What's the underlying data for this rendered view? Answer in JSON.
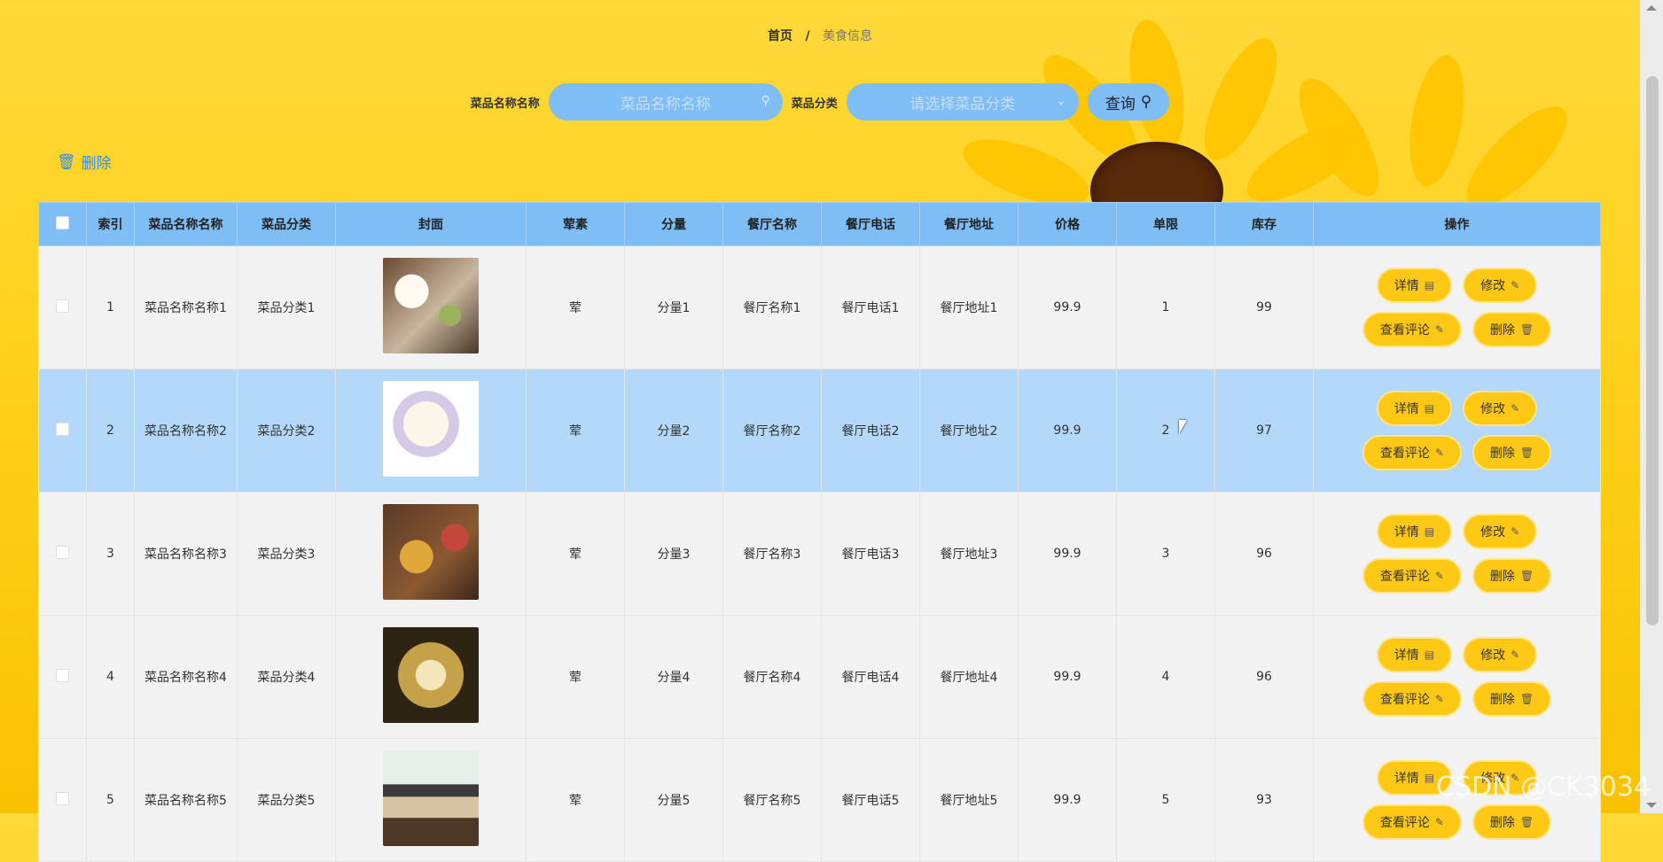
{
  "breadcrumb": {
    "home": "首页",
    "separator": "/",
    "current": "美食信息"
  },
  "search": {
    "name_label": "菜品名称名称",
    "name_placeholder": "菜品名称名称",
    "category_label": "菜品分类",
    "category_placeholder": "请选择菜品分类",
    "query_label": "查询"
  },
  "actions": {
    "delete_label": "删除"
  },
  "table": {
    "headers": [
      "",
      "索引",
      "菜品名称名称",
      "菜品分类",
      "封面",
      "荤素",
      "分量",
      "餐厅名称",
      "餐厅电话",
      "餐厅地址",
      "价格",
      "单限",
      "库存",
      "操作"
    ],
    "rows": [
      {
        "index": "1",
        "name": "菜品名称名称1",
        "category": "菜品分类1",
        "type": "荤",
        "portion": "分量1",
        "restaurant": "餐厅名称1",
        "phone": "餐厅电话1",
        "address": "餐厅地址1",
        "price": "99.9",
        "limit": "1",
        "stock": "99"
      },
      {
        "index": "2",
        "name": "菜品名称名称2",
        "category": "菜品分类2",
        "type": "荤",
        "portion": "分量2",
        "restaurant": "餐厅名称2",
        "phone": "餐厅电话2",
        "address": "餐厅地址2",
        "price": "99.9",
        "limit": "2",
        "stock": "97"
      },
      {
        "index": "3",
        "name": "菜品名称名称3",
        "category": "菜品分类3",
        "type": "荤",
        "portion": "分量3",
        "restaurant": "餐厅名称3",
        "phone": "餐厅电话3",
        "address": "餐厅地址3",
        "price": "99.9",
        "limit": "3",
        "stock": "96"
      },
      {
        "index": "4",
        "name": "菜品名称名称4",
        "category": "菜品分类4",
        "type": "荤",
        "portion": "分量4",
        "restaurant": "餐厅名称4",
        "phone": "餐厅电话4",
        "address": "餐厅地址4",
        "price": "99.9",
        "limit": "4",
        "stock": "96"
      },
      {
        "index": "5",
        "name": "菜品名称名称5",
        "category": "菜品分类5",
        "type": "荤",
        "portion": "分量5",
        "restaurant": "餐厅名称5",
        "phone": "餐厅电话5",
        "address": "餐厅地址5",
        "price": "99.9",
        "limit": "5",
        "stock": "93"
      }
    ],
    "row_buttons": {
      "detail": "详情",
      "edit": "修改",
      "comments": "查看评论",
      "delete": "删除"
    }
  },
  "watermark": "CSDN @CK3034",
  "colors": {
    "primary_blue": "#7fbdf5",
    "button_yellow": "#ffc814",
    "selected_row": "#b3d8fa",
    "background": "#ffd21f"
  },
  "icons": {
    "search": "search-icon",
    "chevron": "chevron-down-icon",
    "trash": "trash-icon",
    "document": "document-icon",
    "pencil": "pencil-icon"
  }
}
